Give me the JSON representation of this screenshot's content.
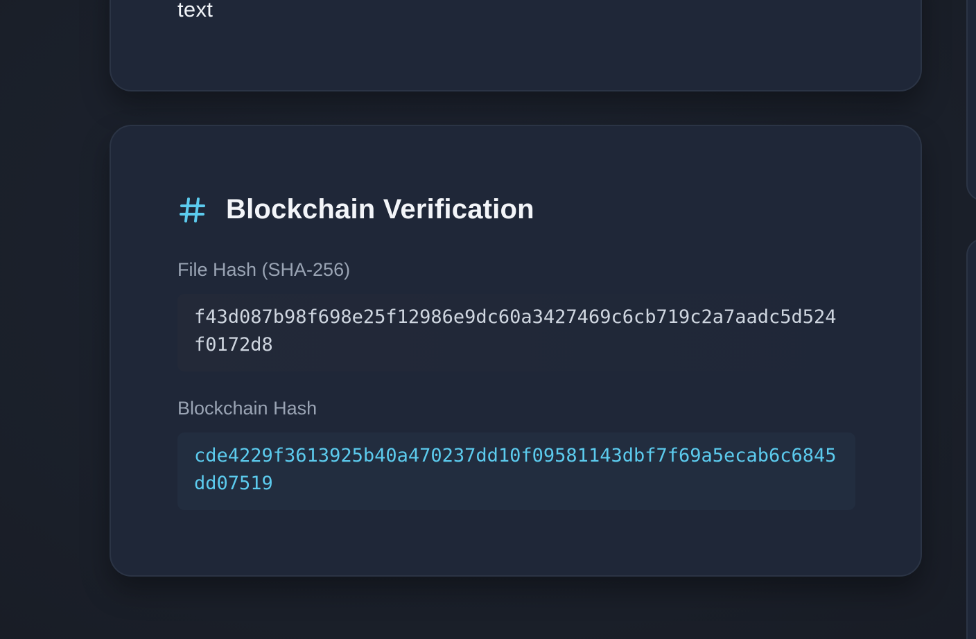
{
  "top_card": {
    "text_fragment": "text"
  },
  "verification": {
    "title": "Blockchain Verification",
    "icon": "hash-icon",
    "file_hash_label": "File Hash (SHA-256)",
    "file_hash_value": "f43d087b98f698e25f12986e9dc60a3427469c6cb719c2a7aadc5d524f0172d8",
    "blockchain_hash_label": "Blockchain Hash",
    "blockchain_hash_value": "cde4229f3613925b40a470237dd10f09581143dbf7f69a5ecab6c6845dd07519"
  },
  "colors": {
    "accent": "#5ccbee",
    "background": "#1b202b",
    "card": "#1f2738",
    "heading": "#f3f5f9",
    "label": "#9aa4b4"
  }
}
